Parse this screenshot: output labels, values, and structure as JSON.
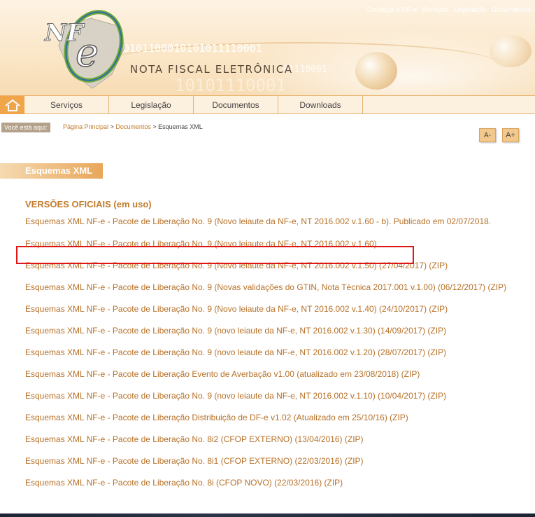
{
  "header": {
    "logo_text": "NF-e",
    "title": "NOTA FISCAL ELETRÔNICA",
    "binary_1": "0101100010101011110001",
    "binary_2": "01110001",
    "binary_3": "10101110001",
    "top_links": [
      "Conheça a NF-e",
      "Serviços",
      "Legislação",
      "Documentos"
    ]
  },
  "nav": {
    "home_icon": "home-icon",
    "items": [
      "Serviços",
      "Legislação",
      "Documentos",
      "Downloads"
    ]
  },
  "breadcrumb": {
    "label": "Você está aqui:",
    "home": "Página Principal",
    "sep": ">",
    "parent": "Documentos",
    "current": "Esquemas XML"
  },
  "font_controls": {
    "decrease": "A-",
    "increase": "A+"
  },
  "section": {
    "title": "Esquemas XML",
    "subsection": "VERSÕES OFICIAIS (em uso)"
  },
  "documents": [
    "Esquemas XML NF-e - Pacote de Liberação No. 9 (Novo leiaute da NF-e, NT 2016.002 v.1.60 - b). Publicado em 02/07/2018.",
    "Esquemas XML NF-e - Pacote de Liberação No. 9 (Novo leiaute da NF-e, NT 2016.002 v.1.60)",
    "Esquemas XML NF-e - Pacote de Liberação No. 9 (Novo leiaute da NF-e, NT 2016.002 v.1.50) (27/04/2017) (ZIP)",
    "Esquemas XML NF-e - Pacote de Liberação No. 9 (Novas validações do GTIN, Nota Técnica 2017.001 v.1.00) (06/12/2017) (ZIP)",
    "Esquemas XML NF-e - Pacote de Liberação No. 9 (Novo leiaute da NF-e, NT 2016.002 v.1.40) (24/10/2017) (ZIP)",
    "Esquemas XML NF-e - Pacote de Liberação No. 9 (novo leiaute da NF-e, NT 2016.002 v.1.30) (14/09/2017) (ZIP)",
    "Esquemas XML NF-e - Pacote de Liberação No. 9 (novo leiaute da NF-e, NT 2016.002 v.1.20) (28/07/2017) (ZIP)",
    "Esquemas XML NF-e - Pacote de Liberação Evento de Averbação v1.00 (atualizado em 23/08/2018) (ZIP)",
    "Esquemas XML NF-e - Pacote de Liberação No. 9 (novo leiaute da NF-e, NT 2016.002 v.1.10) (10/04/2017) (ZIP)",
    "Esquemas XML NF-e - Pacote de Liberação Distribuição de DF-e v1.02 (Atualizado em 25/10/16) (ZIP)",
    "Esquemas XML NF-e - Pacote de Liberação No. 8i2 (CFOP EXTERNO) (13/04/2016) (ZIP)",
    "Esquemas XML NF-e - Pacote de Liberação No. 8i1 (CFOP EXTERNO) (22/03/2016) (ZIP)",
    "Esquemas XML NF-e - Pacote de Liberação No. 8i (CFOP NOVO) (22/03/2016) (ZIP)"
  ],
  "colors": {
    "accent": "#e9a65a",
    "link": "#b77128",
    "highlight_border": "#e01515"
  }
}
